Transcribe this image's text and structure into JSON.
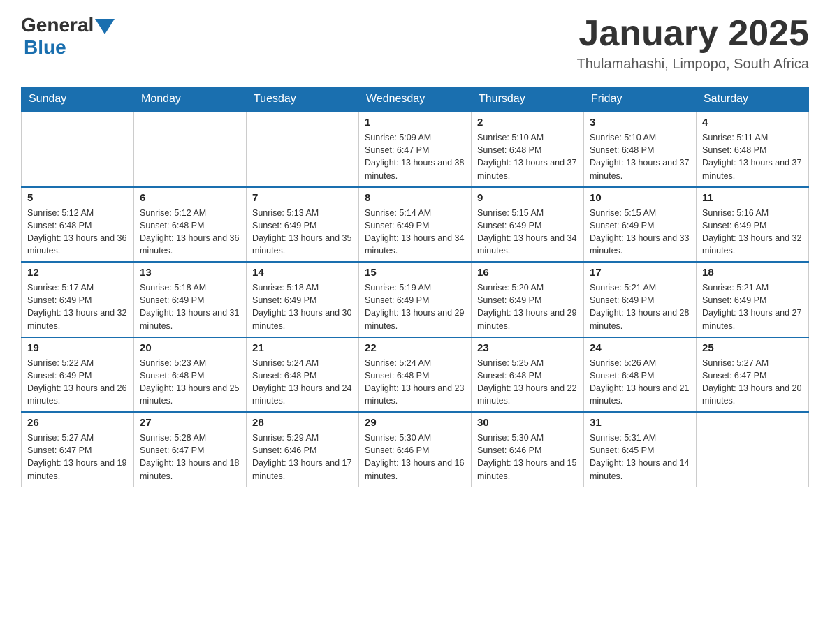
{
  "header": {
    "logo_general": "General",
    "logo_blue": "Blue",
    "month_title": "January 2025",
    "location": "Thulamahashi, Limpopo, South Africa"
  },
  "days_of_week": [
    "Sunday",
    "Monday",
    "Tuesday",
    "Wednesday",
    "Thursday",
    "Friday",
    "Saturday"
  ],
  "weeks": [
    [
      {
        "day": "",
        "info": ""
      },
      {
        "day": "",
        "info": ""
      },
      {
        "day": "",
        "info": ""
      },
      {
        "day": "1",
        "info": "Sunrise: 5:09 AM\nSunset: 6:47 PM\nDaylight: 13 hours and 38 minutes."
      },
      {
        "day": "2",
        "info": "Sunrise: 5:10 AM\nSunset: 6:48 PM\nDaylight: 13 hours and 37 minutes."
      },
      {
        "day": "3",
        "info": "Sunrise: 5:10 AM\nSunset: 6:48 PM\nDaylight: 13 hours and 37 minutes."
      },
      {
        "day": "4",
        "info": "Sunrise: 5:11 AM\nSunset: 6:48 PM\nDaylight: 13 hours and 37 minutes."
      }
    ],
    [
      {
        "day": "5",
        "info": "Sunrise: 5:12 AM\nSunset: 6:48 PM\nDaylight: 13 hours and 36 minutes."
      },
      {
        "day": "6",
        "info": "Sunrise: 5:12 AM\nSunset: 6:48 PM\nDaylight: 13 hours and 36 minutes."
      },
      {
        "day": "7",
        "info": "Sunrise: 5:13 AM\nSunset: 6:49 PM\nDaylight: 13 hours and 35 minutes."
      },
      {
        "day": "8",
        "info": "Sunrise: 5:14 AM\nSunset: 6:49 PM\nDaylight: 13 hours and 34 minutes."
      },
      {
        "day": "9",
        "info": "Sunrise: 5:15 AM\nSunset: 6:49 PM\nDaylight: 13 hours and 34 minutes."
      },
      {
        "day": "10",
        "info": "Sunrise: 5:15 AM\nSunset: 6:49 PM\nDaylight: 13 hours and 33 minutes."
      },
      {
        "day": "11",
        "info": "Sunrise: 5:16 AM\nSunset: 6:49 PM\nDaylight: 13 hours and 32 minutes."
      }
    ],
    [
      {
        "day": "12",
        "info": "Sunrise: 5:17 AM\nSunset: 6:49 PM\nDaylight: 13 hours and 32 minutes."
      },
      {
        "day": "13",
        "info": "Sunrise: 5:18 AM\nSunset: 6:49 PM\nDaylight: 13 hours and 31 minutes."
      },
      {
        "day": "14",
        "info": "Sunrise: 5:18 AM\nSunset: 6:49 PM\nDaylight: 13 hours and 30 minutes."
      },
      {
        "day": "15",
        "info": "Sunrise: 5:19 AM\nSunset: 6:49 PM\nDaylight: 13 hours and 29 minutes."
      },
      {
        "day": "16",
        "info": "Sunrise: 5:20 AM\nSunset: 6:49 PM\nDaylight: 13 hours and 29 minutes."
      },
      {
        "day": "17",
        "info": "Sunrise: 5:21 AM\nSunset: 6:49 PM\nDaylight: 13 hours and 28 minutes."
      },
      {
        "day": "18",
        "info": "Sunrise: 5:21 AM\nSunset: 6:49 PM\nDaylight: 13 hours and 27 minutes."
      }
    ],
    [
      {
        "day": "19",
        "info": "Sunrise: 5:22 AM\nSunset: 6:49 PM\nDaylight: 13 hours and 26 minutes."
      },
      {
        "day": "20",
        "info": "Sunrise: 5:23 AM\nSunset: 6:48 PM\nDaylight: 13 hours and 25 minutes."
      },
      {
        "day": "21",
        "info": "Sunrise: 5:24 AM\nSunset: 6:48 PM\nDaylight: 13 hours and 24 minutes."
      },
      {
        "day": "22",
        "info": "Sunrise: 5:24 AM\nSunset: 6:48 PM\nDaylight: 13 hours and 23 minutes."
      },
      {
        "day": "23",
        "info": "Sunrise: 5:25 AM\nSunset: 6:48 PM\nDaylight: 13 hours and 22 minutes."
      },
      {
        "day": "24",
        "info": "Sunrise: 5:26 AM\nSunset: 6:48 PM\nDaylight: 13 hours and 21 minutes."
      },
      {
        "day": "25",
        "info": "Sunrise: 5:27 AM\nSunset: 6:47 PM\nDaylight: 13 hours and 20 minutes."
      }
    ],
    [
      {
        "day": "26",
        "info": "Sunrise: 5:27 AM\nSunset: 6:47 PM\nDaylight: 13 hours and 19 minutes."
      },
      {
        "day": "27",
        "info": "Sunrise: 5:28 AM\nSunset: 6:47 PM\nDaylight: 13 hours and 18 minutes."
      },
      {
        "day": "28",
        "info": "Sunrise: 5:29 AM\nSunset: 6:46 PM\nDaylight: 13 hours and 17 minutes."
      },
      {
        "day": "29",
        "info": "Sunrise: 5:30 AM\nSunset: 6:46 PM\nDaylight: 13 hours and 16 minutes."
      },
      {
        "day": "30",
        "info": "Sunrise: 5:30 AM\nSunset: 6:46 PM\nDaylight: 13 hours and 15 minutes."
      },
      {
        "day": "31",
        "info": "Sunrise: 5:31 AM\nSunset: 6:45 PM\nDaylight: 13 hours and 14 minutes."
      },
      {
        "day": "",
        "info": ""
      }
    ]
  ]
}
